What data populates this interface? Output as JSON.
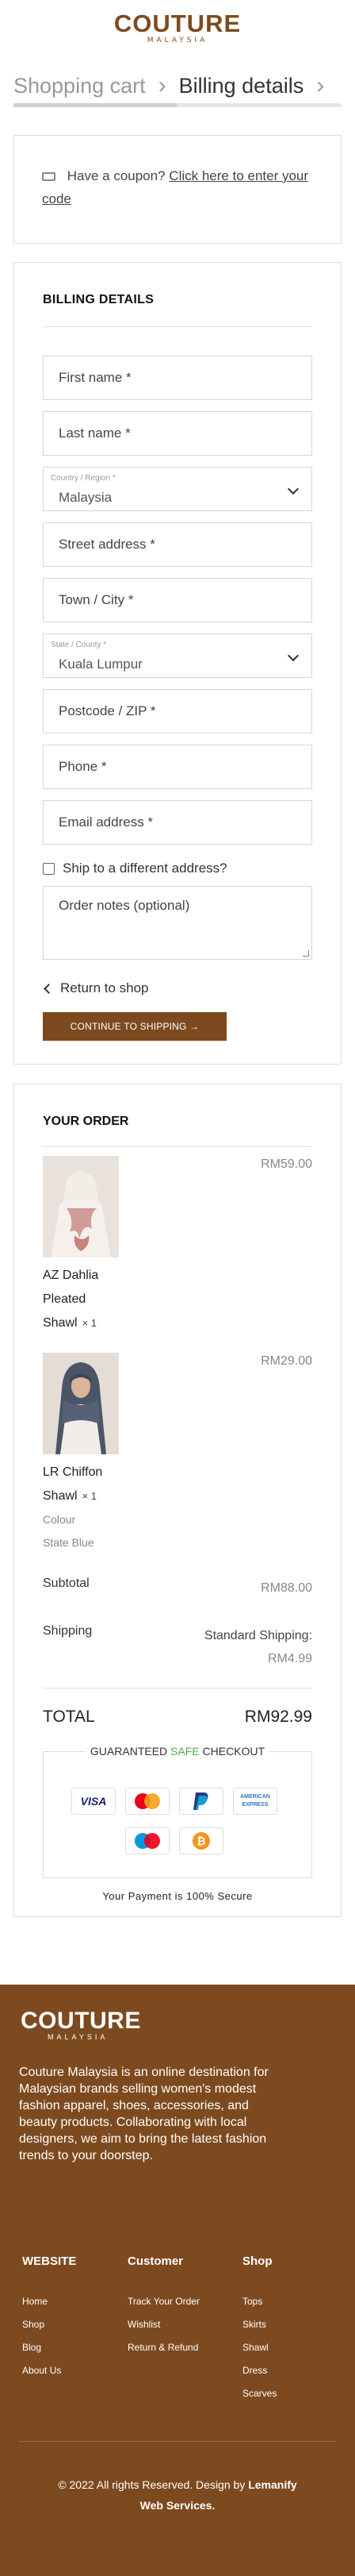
{
  "header": {
    "brand": "COUTURE",
    "brand_sub": "MALAYSIA",
    "steps": [
      "Shopping cart",
      "Billing details"
    ]
  },
  "coupon": {
    "text": "Have a coupon?",
    "link": "Click here to enter your code"
  },
  "billing": {
    "title": "BILLING DETAILS",
    "first_name_ph": "First name *",
    "last_name_ph": "Last name *",
    "country_label": "Country / Region *",
    "country_value": "Malaysia",
    "street_ph": "Street address *",
    "town_ph": "Town / City *",
    "state_label": "State / County *",
    "state_value": "Kuala Lumpur",
    "postcode_ph": "Postcode / ZIP *",
    "phone_ph": "Phone *",
    "email_ph": "Email address *",
    "ship_different": "Ship to a different address?",
    "notes_ph": "Order notes (optional)",
    "return_label": "Return to shop",
    "continue_label": "CONTINUE TO SHIPPING →"
  },
  "order": {
    "title": "YOUR ORDER",
    "items": [
      {
        "name_lines": [
          "AZ Dahlia",
          "Pleated",
          "Shawl"
        ],
        "qty": "× 1",
        "price": "RM59.00"
      },
      {
        "name_lines": [
          "LR Chiffon",
          "Shawl"
        ],
        "qty": "× 1",
        "attr_label": "Colour",
        "attr_value": "State Blue",
        "price": "RM29.00"
      }
    ],
    "subtotal_label": "Subtotal",
    "subtotal_value": "RM88.00",
    "shipping_label": "Shipping",
    "shipping_value_1": "Standard Shipping:",
    "shipping_value_2": "RM4.99",
    "total_label": "TOTAL",
    "total_value": "RM92.99",
    "checkout_title_1": "GUARANTEED",
    "checkout_title_safe": "SAFE",
    "checkout_title_2": "CHECKOUT",
    "payment_icons": [
      "visa-icon",
      "mastercard-icon",
      "paypal-icon",
      "american-express-icon",
      "maestro-icon",
      "bitcoin-icon"
    ],
    "payment_visa": "VISA",
    "payment_amex_1": "AMERICAN",
    "payment_amex_2": "EXPRESS",
    "secure_note": "Your Payment is 100% Secure"
  },
  "footer": {
    "brand": "COUTURE",
    "brand_sub": "MALAYSIA",
    "about": "Couture Malaysia is an online destination for Malaysian brands selling women's modest fashion apparel, shoes, accessories, and beauty products. Collaborating with local designers, we aim to bring the latest fashion trends to your doorstep.",
    "columns": [
      {
        "title": "WEBSITE",
        "links": [
          "Home",
          "Shop",
          "Blog",
          "About Us"
        ]
      },
      {
        "title": "Customer",
        "links": [
          "Track Your Order",
          "Wishlist",
          "Return & Refund"
        ]
      },
      {
        "title": "Shop",
        "links": [
          "Tops",
          "Skirts",
          "Shawl",
          "Dress",
          "Scarves"
        ]
      }
    ],
    "copyright_1": "© 2022 All rights Reserved. Design by",
    "copyright_brand": "Lemanify",
    "copyright_2": "Web Services."
  },
  "colors": {
    "brand": "#7d4a1f",
    "safe": "#4caf50"
  }
}
